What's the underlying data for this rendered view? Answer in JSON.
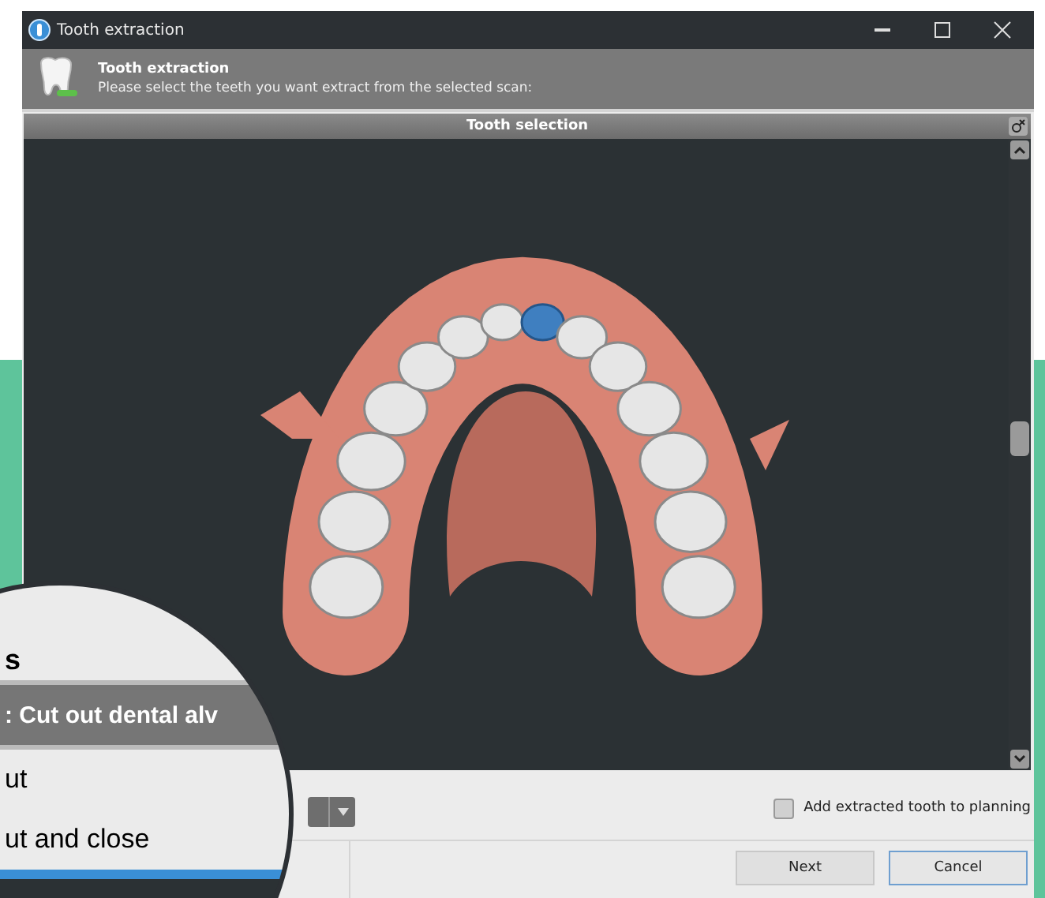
{
  "window": {
    "title": "Tooth extraction"
  },
  "header": {
    "title": "Tooth extraction",
    "subtitle": "Please select the teeth you want extract from the selected scan:"
  },
  "panel": {
    "title": "Tooth selection"
  },
  "teeth": [
    {
      "selected": false
    },
    {
      "selected": false
    },
    {
      "selected": false
    },
    {
      "selected": false
    },
    {
      "selected": false
    },
    {
      "selected": false
    },
    {
      "selected": false
    },
    {
      "selected": true
    },
    {
      "selected": false
    },
    {
      "selected": false
    },
    {
      "selected": false
    },
    {
      "selected": false
    },
    {
      "selected": false
    },
    {
      "selected": false
    }
  ],
  "checkbox": {
    "label": "Add extracted tooth to planning",
    "checked": false
  },
  "buttons": [
    {
      "label": "Next",
      "default": false
    },
    {
      "label": "Cancel",
      "default": true
    }
  ],
  "magnifier": {
    "heading": "s",
    "band": ": Cut out dental alv",
    "options": [
      {
        "label": "ut"
      },
      {
        "label": "ut and close"
      }
    ]
  }
}
